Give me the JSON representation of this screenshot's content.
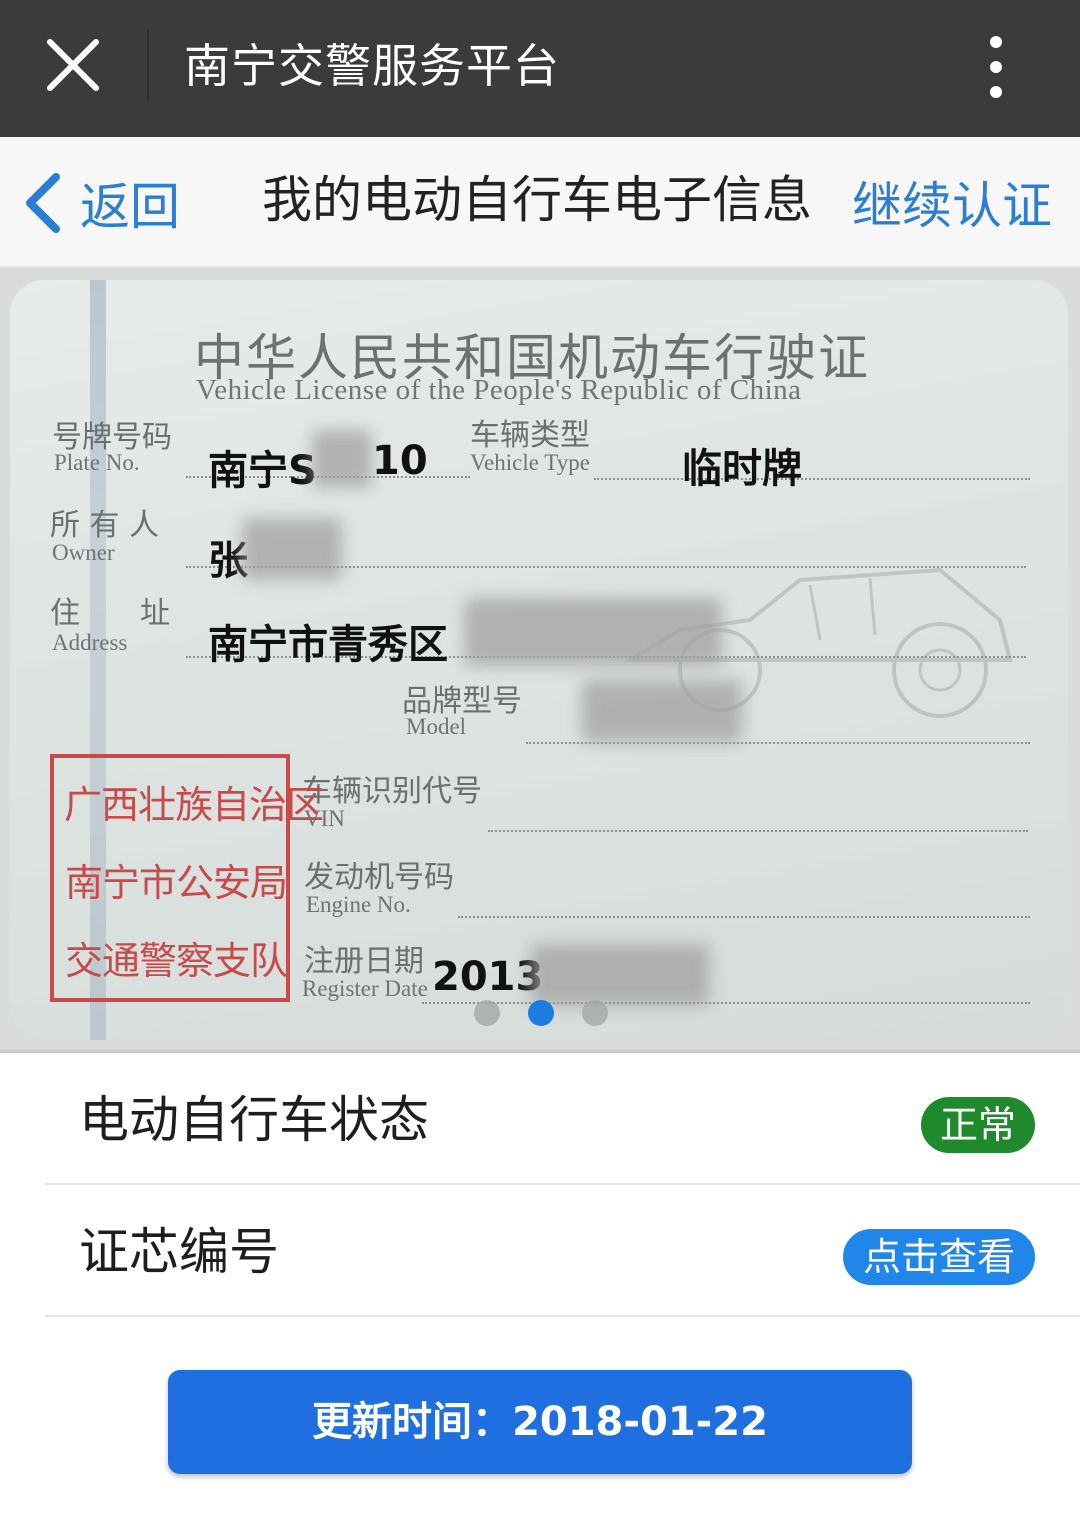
{
  "topbar": {
    "title": "南宁交警服务平台"
  },
  "navbar": {
    "back_label": "返回",
    "title": "我的电动自行车电子信息",
    "right_action": "继续认证"
  },
  "license": {
    "title_cn": "中华人民共和国机动车行驶证",
    "title_en": "Vehicle License of the People's Republic of China",
    "fields": {
      "plate": {
        "label_cn": "号牌号码",
        "label_en": "Plate No.",
        "value_prefix": "南宁S",
        "value_suffix": "10"
      },
      "vehicle_type": {
        "label_cn": "车辆类型",
        "label_en": "Vehicle Type",
        "value": "临时牌"
      },
      "owner": {
        "label_cn": "所 有 人",
        "label_en": "Owner",
        "value": "张"
      },
      "address": {
        "label_cn": "住　　址",
        "label_en": "Address",
        "value": "南宁市青秀区"
      },
      "model": {
        "label_cn": "品牌型号",
        "label_en": "Model"
      },
      "vin": {
        "label_cn": "车辆识别代号",
        "label_en": "VIN"
      },
      "engine": {
        "label_cn": "发动机号码",
        "label_en": "Engine No."
      },
      "register": {
        "label_cn": "注册日期",
        "label_en": "Register Date",
        "value": "2013"
      }
    },
    "stamp": {
      "line1": "广西壮族自治区",
      "line2": "南宁市公安局",
      "line3": "交通警察支队"
    }
  },
  "carousel": {
    "count": 3,
    "active": 2
  },
  "rows": {
    "status": {
      "label": "电动自行车状态",
      "badge": "正常"
    },
    "chip": {
      "label": "证芯编号",
      "badge": "点击查看"
    }
  },
  "update": {
    "label": "更新时间：",
    "date": "2018-01-22"
  },
  "colors": {
    "accent": "#2a7fd4",
    "topbar": "#3b3b3b",
    "ok_green": "#1e8a2b",
    "button_blue": "#1f6fe0",
    "stamp_red": "#c84a4a"
  }
}
